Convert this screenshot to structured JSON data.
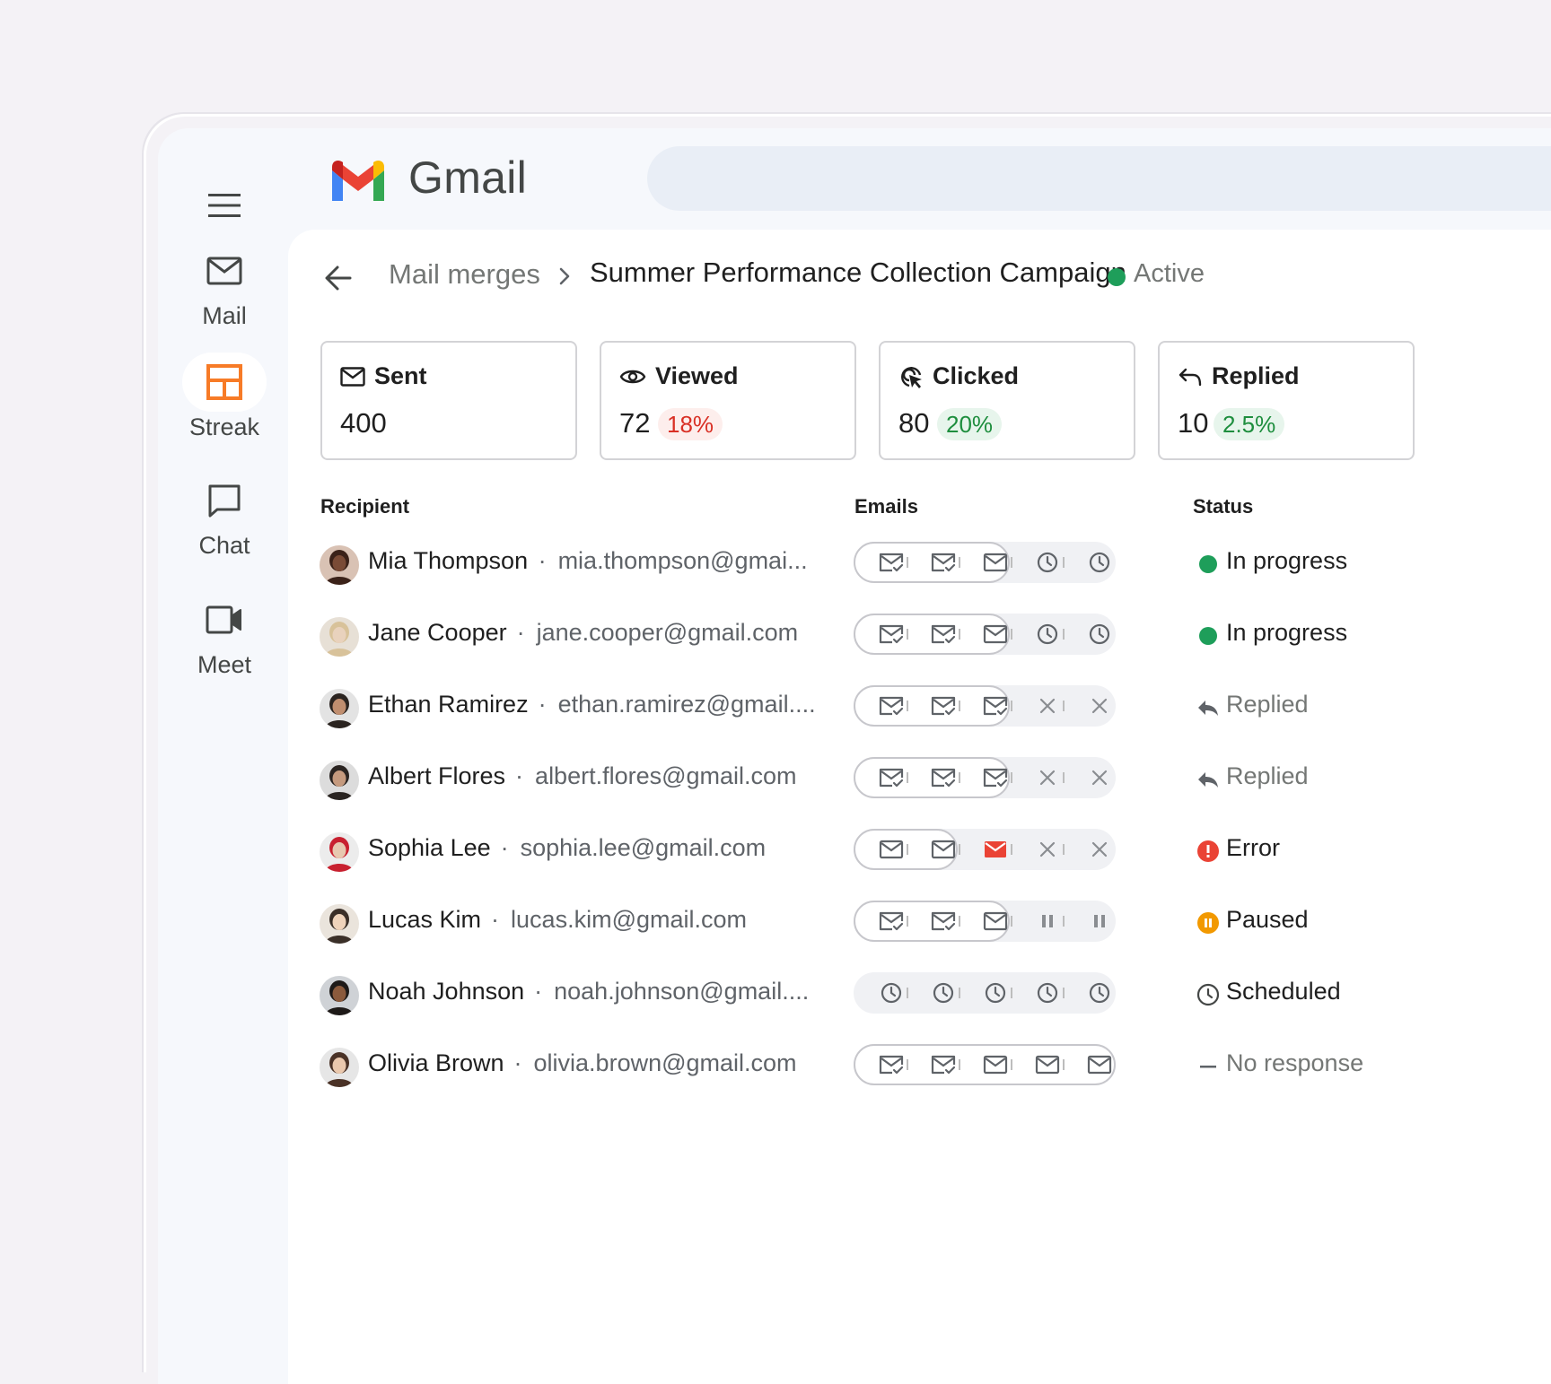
{
  "app": {
    "brand": "Gmail"
  },
  "rail": [
    {
      "label": "Mail",
      "icon": "mail-icon",
      "active": false
    },
    {
      "label": "Streak",
      "icon": "streak-icon",
      "active": true
    },
    {
      "label": "Chat",
      "icon": "chat-icon",
      "active": false
    },
    {
      "label": "Meet",
      "icon": "video-icon",
      "active": false
    }
  ],
  "breadcrumb": {
    "parent": "Mail merges",
    "title": "Summer Performance Collection Campaign",
    "status": "Active"
  },
  "stats": [
    {
      "title": "Sent",
      "value": "400",
      "percent": "",
      "icon": "mail-icon"
    },
    {
      "title": "Viewed",
      "value": "72",
      "percent": "18%",
      "tone": "red",
      "icon": "eye-icon"
    },
    {
      "title": "Clicked",
      "value": "80",
      "percent": "20%",
      "tone": "green",
      "icon": "cursor-click-icon"
    },
    {
      "title": "Replied",
      "value": "10",
      "percent": "2.5%",
      "tone": "green",
      "icon": "reply-icon"
    }
  ],
  "table": {
    "headers": {
      "recipient": "Recipient",
      "emails": "Emails",
      "status": "Status"
    },
    "rows": [
      {
        "name": "Mia Thompson",
        "email": "mia.thompson@gmai...",
        "emails": [
          "mail-check",
          "mail-check",
          "mail",
          "clock",
          "clock"
        ],
        "status": "In progress",
        "status_icon": "green-dot-icon"
      },
      {
        "name": "Jane Cooper",
        "email": "jane.cooper@gmail.com",
        "emails": [
          "mail-check",
          "mail-check",
          "mail",
          "clock",
          "clock"
        ],
        "status": "In progress",
        "status_icon": "green-dot-icon"
      },
      {
        "name": "Ethan Ramirez",
        "email": "ethan.ramirez@gmail....",
        "emails": [
          "mail-check",
          "mail-check",
          "mail-check",
          "x",
          "x"
        ],
        "status": "Replied",
        "status_icon": "reply-arrow-icon"
      },
      {
        "name": "Albert Flores",
        "email": "albert.flores@gmail.com",
        "emails": [
          "mail-check",
          "mail-check",
          "mail-check",
          "x",
          "x"
        ],
        "status": "Replied",
        "status_icon": "reply-arrow-icon"
      },
      {
        "name": "Sophia Lee",
        "email": "sophia.lee@gmail.com",
        "emails": [
          "mail",
          "mail",
          "mail-error",
          "x",
          "x"
        ],
        "status": "Error",
        "status_icon": "error-icon"
      },
      {
        "name": "Lucas Kim",
        "email": "lucas.kim@gmail.com",
        "emails": [
          "mail-check",
          "mail-check",
          "mail",
          "pause",
          "pause"
        ],
        "status": "Paused",
        "status_icon": "paused-icon"
      },
      {
        "name": "Noah Johnson",
        "email": "noah.johnson@gmail....",
        "emails": [
          "clock",
          "clock",
          "clock",
          "clock",
          "clock"
        ],
        "status": "Scheduled",
        "status_icon": "clock-icon"
      },
      {
        "name": "Olivia Brown",
        "email": "olivia.brown@gmail.com",
        "emails": [
          "mail-check",
          "mail-check",
          "mail",
          "mail",
          "mail"
        ],
        "status": "No response",
        "status_icon": "dash-icon"
      }
    ]
  },
  "colors": {
    "green": "#1e9e5a",
    "red": "#ea4335",
    "orange": "#f29900",
    "streak": "#f77b27"
  }
}
